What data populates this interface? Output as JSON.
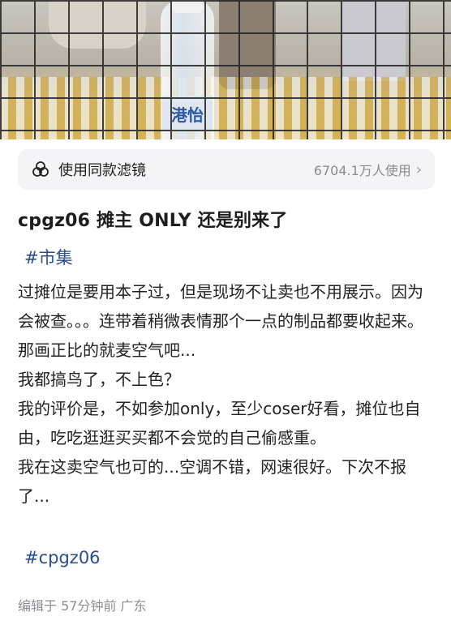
{
  "filter": {
    "icon": "filter-circles-icon",
    "label": "使用同款滤镜",
    "usage": "6704.1万人使用"
  },
  "photo": {
    "bottle_label": "港怡"
  },
  "post": {
    "title": "cpgz06 摊主 ONLY 还是别来了",
    "topic_tag": "#市集",
    "paragraphs": [
      "过摊位是要用本子过，但是现场不让卖也不用展示。因为会被查。。。连带着稍微表情那个一点的制品都要收起来。",
      "那画正比的就麦空气吧...",
      "我都搞鸟了，不上色？",
      "我的评价是，不如参加only，至少coser好看，摊位也自由，吃吃逛逛买买都不会觉的自己偷感重。",
      "我在这卖空气也可的...空调不错，网速很好。下次不报了..."
    ],
    "bottom_tag": "#cpgz06",
    "meta": "编辑于 57分钟前 广东"
  }
}
